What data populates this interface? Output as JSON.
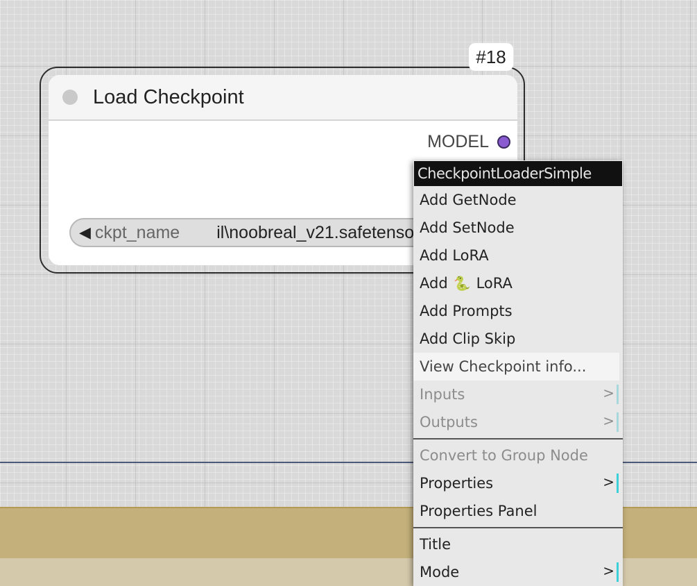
{
  "node": {
    "id_badge": "#18",
    "title": "Load Checkpoint",
    "output_label": "MODEL",
    "widget": {
      "arrow": "◀",
      "label": "ckpt_name",
      "value": "il\\noobreal_v21.safetensors"
    },
    "colors": {
      "output_slot": "#8a5bd0",
      "status_dot": "#c9c9c9"
    }
  },
  "context_menu": {
    "title": "CheckpointLoaderSimple",
    "items": [
      {
        "label": "Add GetNode"
      },
      {
        "label": "Add SetNode"
      },
      {
        "label": "Add LoRA"
      },
      {
        "label_prefix": "Add",
        "icon": "snake-icon",
        "icon_glyph": "🐍",
        "label_suffix": "LoRA"
      },
      {
        "label": "Add Prompts"
      },
      {
        "label": "Add Clip Skip"
      },
      {
        "label": "View Checkpoint info..."
      },
      {
        "label": "Inputs",
        "submenu_arrow": ">"
      },
      {
        "label": "Outputs",
        "submenu_arrow": ">"
      },
      {
        "label": "Convert to Group Node"
      },
      {
        "label": "Properties",
        "submenu_arrow": ">"
      },
      {
        "label": "Properties Panel"
      },
      {
        "label": "Title"
      },
      {
        "label": "Mode",
        "submenu_arrow": ">"
      }
    ],
    "colors": {
      "title_bg": "#111111",
      "submenu_indicator": "#3cd0d8"
    }
  }
}
